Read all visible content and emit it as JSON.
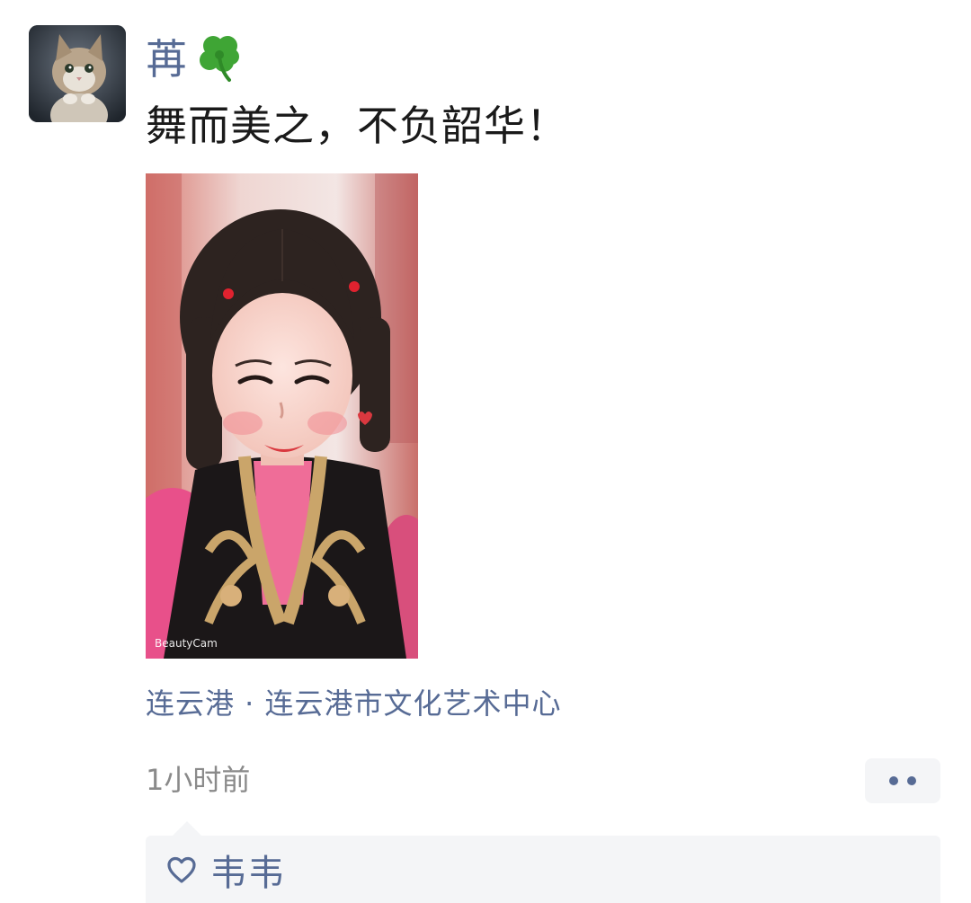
{
  "post": {
    "author": "苒",
    "author_emoji_icon": "four-leaf-clover-icon",
    "text": "舞而美之，不负韶华！",
    "photo_watermark": "BeautyCam",
    "location": "连云港 · 连云港市文化艺术中心",
    "time": "1小时前"
  },
  "likes": {
    "icon": "heart-outline-icon",
    "names": "韦韦"
  },
  "colors": {
    "name_blue": "#576b95",
    "text": "#1a1a1a",
    "meta_gray": "#8a8a8a",
    "panel_bg": "#f4f5f7"
  }
}
